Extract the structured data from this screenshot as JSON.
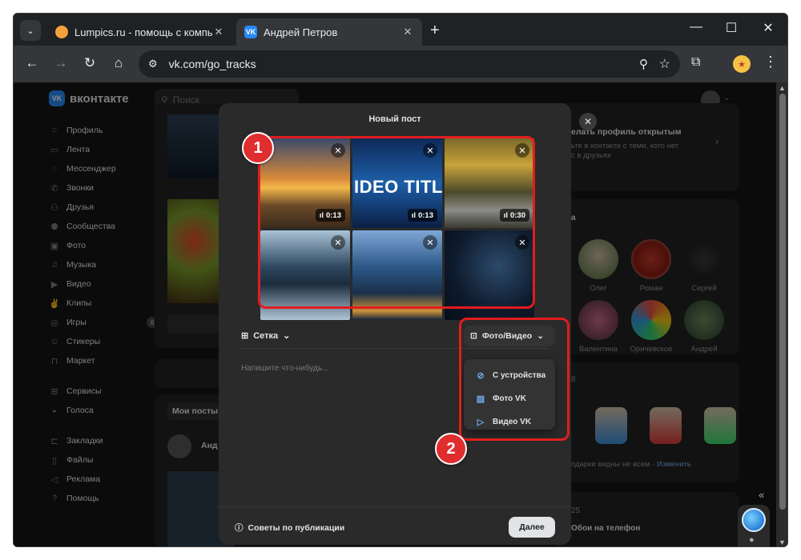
{
  "browser": {
    "tabs": [
      {
        "title": "Lumpics.ru - помощь с компьютером",
        "favicon": "lumpics-icon"
      },
      {
        "title": "Андрей Петров",
        "favicon": "vk-icon"
      }
    ],
    "url": "vk.com/go_tracks"
  },
  "vk": {
    "logo": "вконтакте",
    "search_placeholder": "Поиск",
    "menu": [
      {
        "label": "Профиль",
        "icon": "profile-icon"
      },
      {
        "label": "Лента",
        "icon": "feed-icon"
      },
      {
        "label": "Мессенджер",
        "icon": "messenger-icon"
      },
      {
        "label": "Звонки",
        "icon": "calls-icon"
      },
      {
        "label": "Друзья",
        "icon": "friends-icon"
      },
      {
        "label": "Сообщества",
        "icon": "communities-icon"
      },
      {
        "label": "Фото",
        "icon": "photo-icon"
      },
      {
        "label": "Музыка",
        "icon": "music-icon"
      },
      {
        "label": "Видео",
        "icon": "video-icon"
      },
      {
        "label": "Клипы",
        "icon": "clips-icon"
      },
      {
        "label": "Игры",
        "icon": "games-icon",
        "count": "6"
      },
      {
        "label": "Стикеры",
        "icon": "stickers-icon"
      },
      {
        "label": "Маркет",
        "icon": "market-icon"
      },
      {
        "label": "Сервисы",
        "icon": "services-icon"
      },
      {
        "label": "Голоса",
        "icon": "votes-icon"
      },
      {
        "label": "Закладки",
        "icon": "bookmarks-icon"
      },
      {
        "label": "Файлы",
        "icon": "files-icon"
      },
      {
        "label": "Реклама",
        "icon": "ads-icon"
      },
      {
        "label": "Помощь",
        "icon": "help-icon"
      }
    ],
    "feed": {
      "my_posts": "Мои посты",
      "author_partial": "Анд"
    },
    "right": {
      "profile_title": "елать профиль открытым",
      "profile_line1": "ьте в контакте с теми, кого нет",
      "profile_line2": "с в друзьях",
      "friends_header": "а",
      "friends": [
        {
          "name": "Олег"
        },
        {
          "name": "Роман"
        },
        {
          "name": "Сергей"
        },
        {
          "name": "Валентина"
        },
        {
          "name": "Оричевское"
        },
        {
          "name": "Андрей"
        }
      ],
      "gifts_count": "8",
      "gifts_note": "одарки видны не всем",
      "gifts_change": "Изменить",
      "wall_count": "25",
      "wall_item": "Обои на телефон"
    }
  },
  "modal": {
    "title": "Новый пост",
    "tiles": [
      {
        "type": "video",
        "duration": "0:13"
      },
      {
        "type": "video",
        "duration": "0:13",
        "overlay_text": "IDEO TITL"
      },
      {
        "type": "video",
        "duration": "0:30"
      },
      {
        "type": "photo"
      },
      {
        "type": "photo"
      },
      {
        "type": "photo"
      }
    ],
    "layout_label": "Сетка",
    "media_button": "Фото/Видео",
    "compose_placeholder": "Напишите что-нибудь...",
    "dropdown": [
      {
        "label": "С устройства",
        "icon": "paperclip-icon"
      },
      {
        "label": "Фото VK",
        "icon": "image-icon"
      },
      {
        "label": "Видео VK",
        "icon": "video-icon"
      }
    ],
    "tips": "Советы по публикации",
    "next": "Далее"
  },
  "annotations": {
    "badge1": "1",
    "badge2": "2",
    "color": "#e11d1d"
  }
}
